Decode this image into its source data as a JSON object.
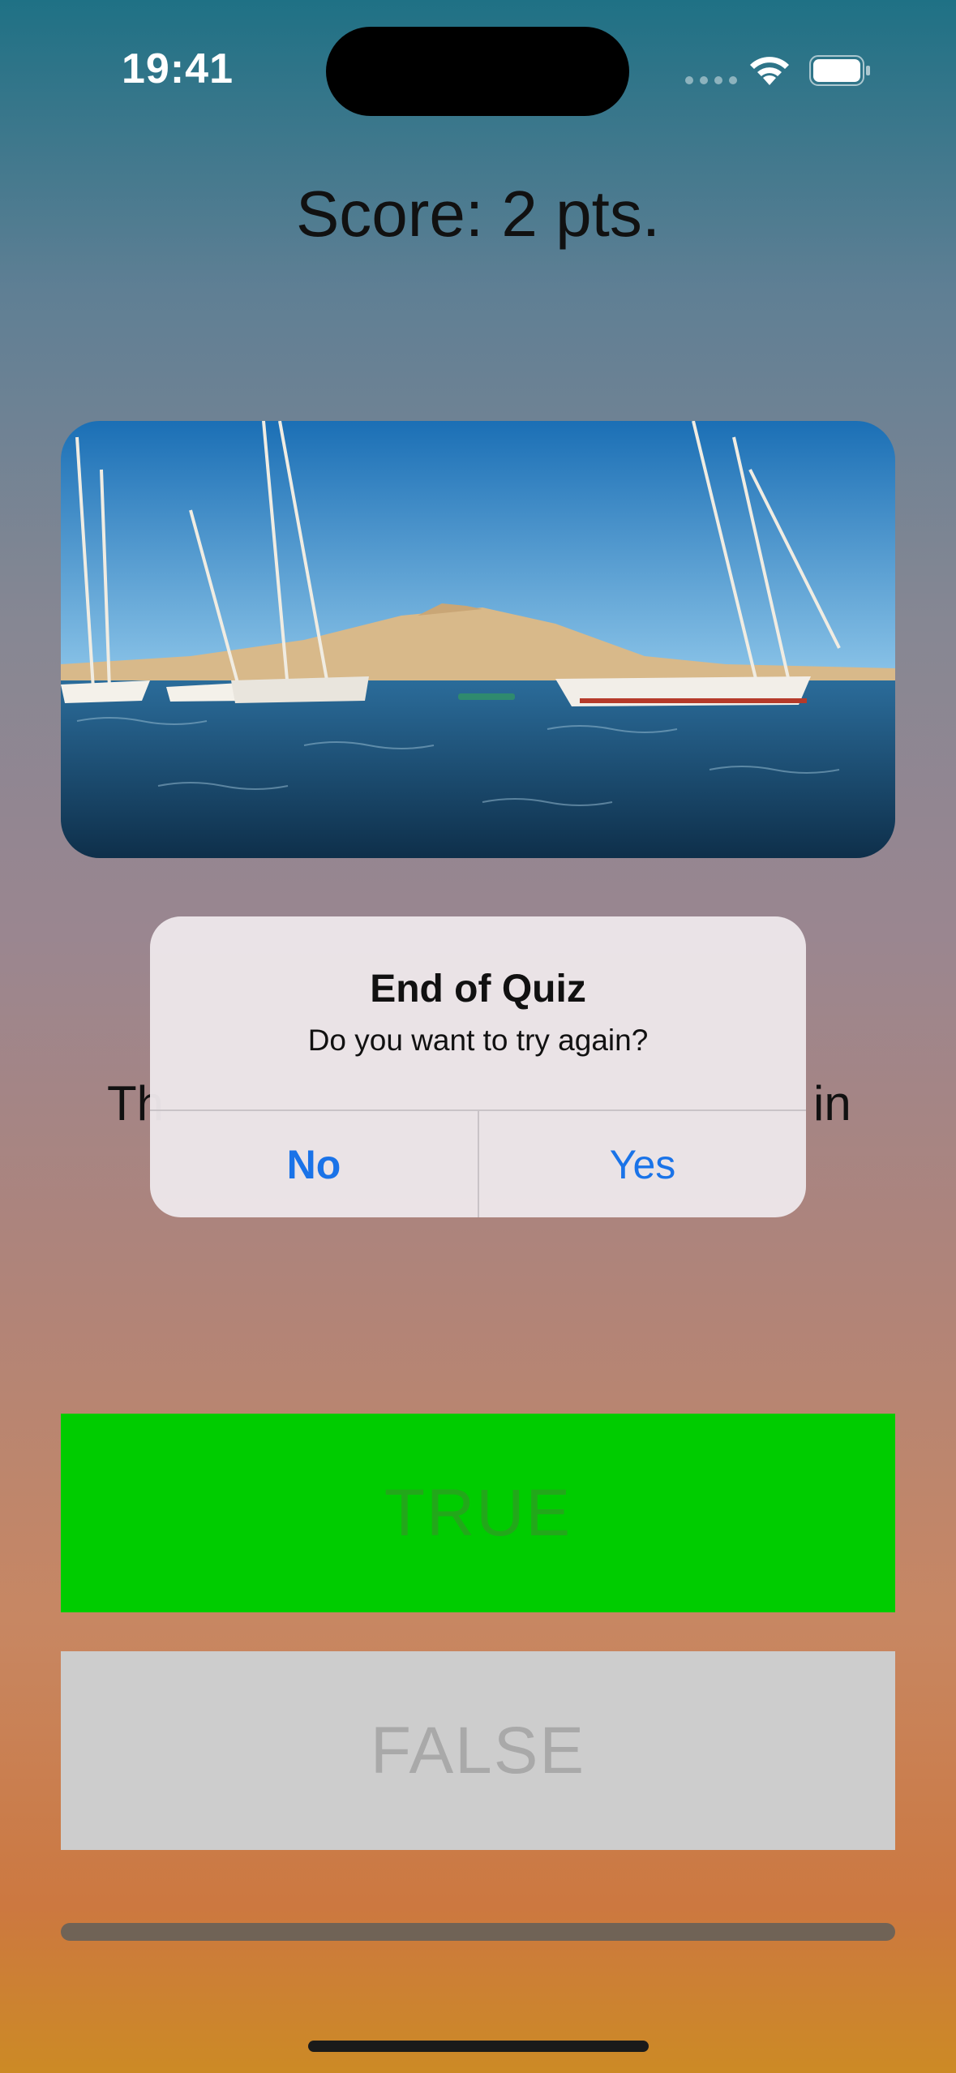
{
  "status_bar": {
    "time": "19:41"
  },
  "quiz": {
    "score": "Score: 2 pts.",
    "question_fragment_left": "Th",
    "question_fragment_right": "in",
    "true_label": "TRUE",
    "false_label": "FALSE",
    "progress": 1.0
  },
  "alert": {
    "title": "End of Quiz",
    "message": "Do you want to try again?",
    "no_label": "No",
    "yes_label": "Yes"
  },
  "colors": {
    "true_button": "#00cc00",
    "false_button": "#cdcdcd",
    "alert_action": "#1a73e8"
  },
  "icons": [
    "signal-icon",
    "wifi-icon",
    "battery-icon"
  ]
}
